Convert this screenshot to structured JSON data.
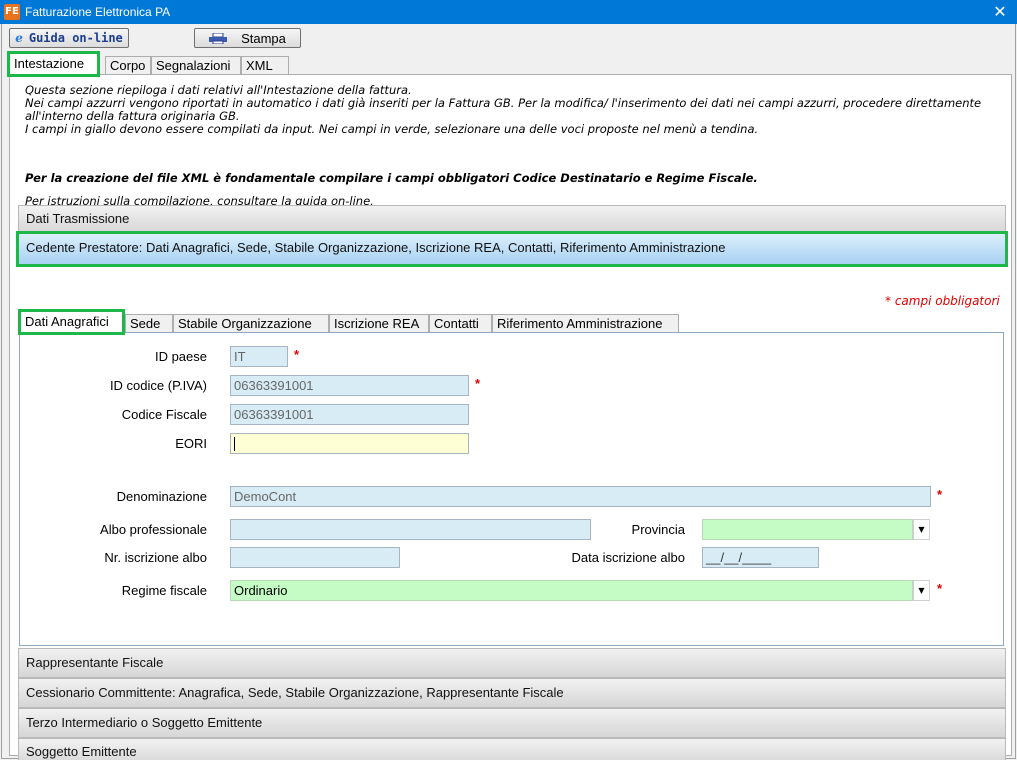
{
  "window": {
    "title": "Fatturazione Elettronica PA",
    "icon_text": "FE",
    "close": "✕"
  },
  "toolbar": {
    "guida_label": "Guida on-line",
    "guida_icon": "e",
    "stampa_label": "Stampa"
  },
  "tabs": [
    {
      "label": "Intestazione"
    },
    {
      "label": "Corpo"
    },
    {
      "label": "Segnalazioni"
    },
    {
      "label": "XML"
    }
  ],
  "info": {
    "line1": "Questa sezione riepiloga i dati relativi all'Intestazione della fattura.",
    "line2": "Nei campi azzurri vengono riportati in automatico i dati già inseriti per la Fattura GB. Per la modifica/ l'inserimento dei dati nei campi azzurri, procedere direttamente",
    "line3": "all'interno della fattura originaria GB.",
    "line4": "I campi in giallo devono essere compilati da input. Nei campi in verde, selezionare una delle voci proposte nel menù a tendina.",
    "bold": "Per la creazione del file XML è fondamentale compilare i campi obbligatori Codice Destinatario e Regime Fiscale.",
    "guida": "Per istruzioni sulla compilazione, consultare la guida on-line."
  },
  "sections": {
    "dati_trasmissione": "Dati Trasmissione",
    "cedente": "Cedente Prestatore: Dati Anagrafici, Sede, Stabile Organizzazione, Iscrizione REA, Contatti, Riferimento Amministrazione",
    "rappresentante": "Rappresentante Fiscale",
    "cessionario": "Cessionario Committente: Anagrafica, Sede, Stabile Organizzazione, Rappresentante Fiscale",
    "terzo": "Terzo Intermediario o Soggetto Emittente",
    "soggetto": "Soggetto Emittente"
  },
  "required_note": "* campi obbligatori",
  "sub_tabs": [
    {
      "label": "Dati Anagrafici"
    },
    {
      "label": "Sede"
    },
    {
      "label": "Stabile Organizzazione"
    },
    {
      "label": "Iscrizione REA"
    },
    {
      "label": "Contatti"
    },
    {
      "label": "Riferimento Amministrazione"
    }
  ],
  "form": {
    "id_paese": {
      "label": "ID paese",
      "value": "IT"
    },
    "id_codice": {
      "label": "ID codice (P.IVA)",
      "value": "06363391001"
    },
    "codice_fiscale": {
      "label": "Codice Fiscale",
      "value": "06363391001"
    },
    "eori": {
      "label": "EORI",
      "value": ""
    },
    "denominazione": {
      "label": "Denominazione",
      "value": "DemoCont"
    },
    "albo": {
      "label": "Albo professionale",
      "value": ""
    },
    "provincia": {
      "label": "Provincia",
      "value": ""
    },
    "nr_iscrizione": {
      "label": "Nr. iscrizione albo",
      "value": ""
    },
    "data_iscrizione": {
      "label": "Data iscrizione albo",
      "value": "__/__/____"
    },
    "regime": {
      "label": "Regime fiscale",
      "value": "Ordinario"
    }
  },
  "required_mark": "*",
  "dropdown_arrow": "▼",
  "colors": {
    "title_bar": "#0078d7",
    "highlight": "#1eb84a",
    "auto_field": "#d8ecf6",
    "input_field": "#ffffd6",
    "select_field": "#c5fbc4",
    "required": "#e00000"
  }
}
